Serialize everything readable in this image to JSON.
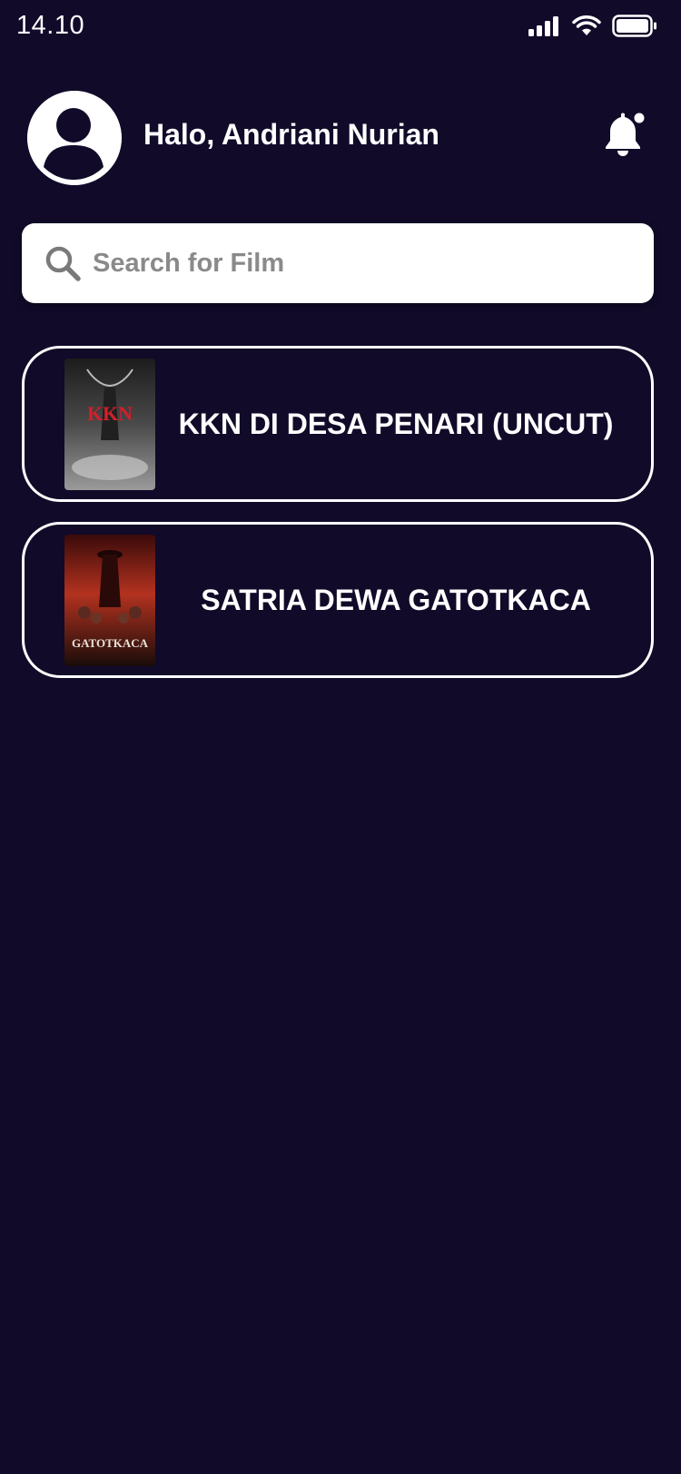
{
  "status_bar": {
    "time": "14.10",
    "icons": [
      "signal-icon",
      "wifi-icon",
      "battery-icon"
    ]
  },
  "header": {
    "avatar_icon": "user-avatar-icon",
    "greeting": "Halo, Andriani Nurian",
    "notification_icon": "bell-icon"
  },
  "search": {
    "placeholder": "Search for Film",
    "value": "",
    "icon": "search-icon"
  },
  "films": [
    {
      "title": "KKN DI DESA PENARI (UNCUT)",
      "poster_text": "KKN"
    },
    {
      "title": "SATRIA DEWA GATOTKACA",
      "poster_text": "GATOTKACA"
    }
  ],
  "colors": {
    "background": "#110a29",
    "card_border": "#ffffff",
    "search_background": "#ffffff",
    "placeholder": "#8a8a8a"
  }
}
